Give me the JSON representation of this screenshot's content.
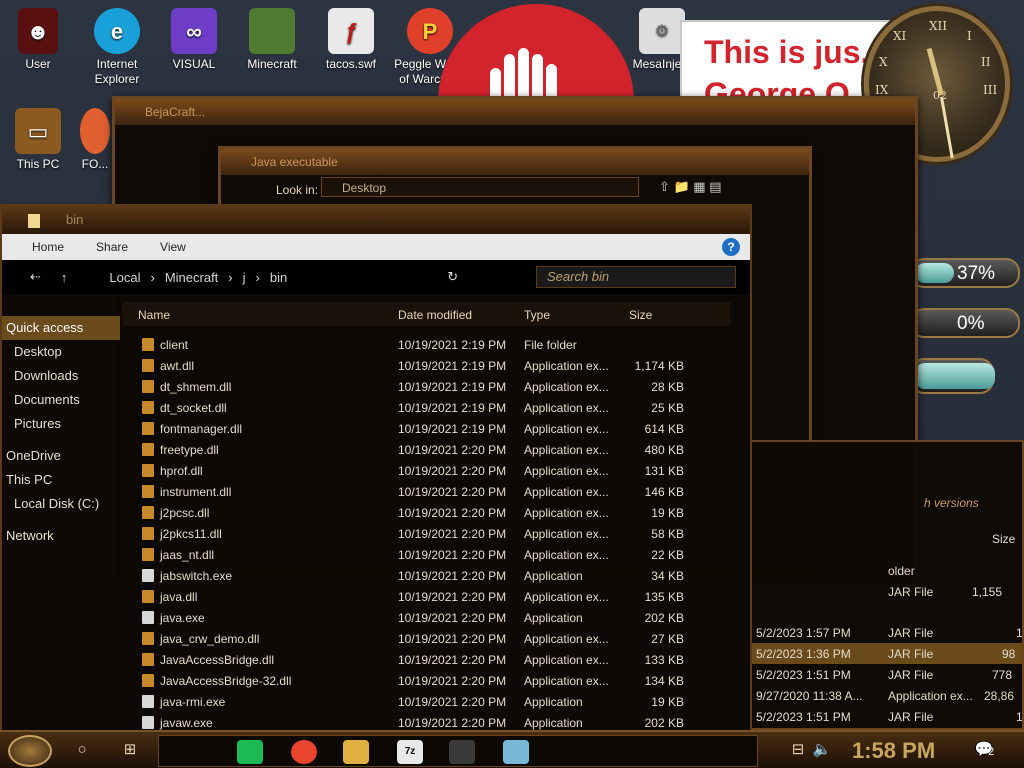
{
  "desktop_icons": [
    {
      "label": "User",
      "icon": "user-icon",
      "color": "#6a1010"
    },
    {
      "label": "Internet Explorer",
      "icon": "ie-icon",
      "color": "#1aa0d8"
    },
    {
      "label": "VISUAL",
      "icon": "visual-studio-icon",
      "color": "#6e3ec8"
    },
    {
      "label": "Minecraft",
      "icon": "minecraft-icon",
      "color": "#4f7a30"
    },
    {
      "label": "tacos.swf",
      "icon": "flash-file-icon",
      "color": "#e9e9e9"
    },
    {
      "label": "Peggle World of Warcra...",
      "icon": "peggle-icon",
      "color": "#e0402a"
    },
    {
      "label": "MesaInje...",
      "icon": "mesa-icon",
      "color": "#dddddd"
    },
    {
      "label": "This PC",
      "icon": "this-pc-icon",
      "color": "#8a5a20"
    },
    {
      "label": "FO...",
      "icon": "fo-icon",
      "color": "#e06030"
    }
  ],
  "banner": {
    "line1": "This is jus...",
    "line2": "George O..."
  },
  "clock": {
    "numerals": [
      "XII",
      "I",
      "II",
      "III",
      "IX",
      "X",
      "XI"
    ],
    "sub": "02"
  },
  "gauges": [
    {
      "label": "37%",
      "value": 0.37
    },
    {
      "label": "0%",
      "value": 0.0
    }
  ],
  "back_window1": {
    "title": "BejaCraft..."
  },
  "dialog": {
    "title": "Java executable",
    "look_in_label": "Look in:",
    "look_in_value": "Desktop"
  },
  "explorer": {
    "title": "bin",
    "ribbon_tabs": [
      "Home",
      "Share",
      "View"
    ],
    "breadcrumb": [
      "Local",
      "Minecraft",
      "j",
      "bin"
    ],
    "search_placeholder": "Search bin",
    "columns": {
      "name": "Name",
      "date": "Date modified",
      "type": "Type",
      "size": "Size"
    },
    "nav": {
      "quick_access": "Quick access",
      "desktop": "Desktop",
      "downloads": "Downloads",
      "documents": "Documents",
      "pictures": "Pictures",
      "onedrive": "OneDrive",
      "this_pc": "This PC",
      "local_disk": "Local Disk (C:)",
      "network": "Network"
    },
    "files": [
      {
        "name": "client",
        "date": "10/19/2021 2:19 PM",
        "type": "File folder",
        "size": ""
      },
      {
        "name": "awt.dll",
        "date": "10/19/2021 2:19 PM",
        "type": "Application ex...",
        "size": "1,174 KB"
      },
      {
        "name": "dt_shmem.dll",
        "date": "10/19/2021 2:19 PM",
        "type": "Application ex...",
        "size": "28 KB"
      },
      {
        "name": "dt_socket.dll",
        "date": "10/19/2021 2:19 PM",
        "type": "Application ex...",
        "size": "25 KB"
      },
      {
        "name": "fontmanager.dll",
        "date": "10/19/2021 2:19 PM",
        "type": "Application ex...",
        "size": "614 KB"
      },
      {
        "name": "freetype.dll",
        "date": "10/19/2021 2:20 PM",
        "type": "Application ex...",
        "size": "480 KB"
      },
      {
        "name": "hprof.dll",
        "date": "10/19/2021 2:20 PM",
        "type": "Application ex...",
        "size": "131 KB"
      },
      {
        "name": "instrument.dll",
        "date": "10/19/2021 2:20 PM",
        "type": "Application ex...",
        "size": "146 KB"
      },
      {
        "name": "j2pcsc.dll",
        "date": "10/19/2021 2:20 PM",
        "type": "Application ex...",
        "size": "19 KB"
      },
      {
        "name": "j2pkcs11.dll",
        "date": "10/19/2021 2:20 PM",
        "type": "Application ex...",
        "size": "58 KB"
      },
      {
        "name": "jaas_nt.dll",
        "date": "10/19/2021 2:20 PM",
        "type": "Application ex...",
        "size": "22 KB"
      },
      {
        "name": "jabswitch.exe",
        "date": "10/19/2021 2:20 PM",
        "type": "Application",
        "size": "34 KB"
      },
      {
        "name": "java.dll",
        "date": "10/19/2021 2:20 PM",
        "type": "Application ex...",
        "size": "135 KB"
      },
      {
        "name": "java.exe",
        "date": "10/19/2021 2:20 PM",
        "type": "Application",
        "size": "202 KB"
      },
      {
        "name": "java_crw_demo.dll",
        "date": "10/19/2021 2:20 PM",
        "type": "Application ex...",
        "size": "27 KB"
      },
      {
        "name": "JavaAccessBridge.dll",
        "date": "10/19/2021 2:20 PM",
        "type": "Application ex...",
        "size": "133 KB"
      },
      {
        "name": "JavaAccessBridge-32.dll",
        "date": "10/19/2021 2:20 PM",
        "type": "Application ex...",
        "size": "134 KB"
      },
      {
        "name": "java-rmi.exe",
        "date": "10/19/2021 2:20 PM",
        "type": "Application",
        "size": "19 KB"
      },
      {
        "name": "javaw.exe",
        "date": "10/19/2021 2:20 PM",
        "type": "Application",
        "size": "202 KB"
      }
    ]
  },
  "right_list": {
    "header_label": "h versions",
    "size_label": "Size",
    "rows": [
      {
        "date": "",
        "type": "older",
        "size": ""
      },
      {
        "date": "",
        "type": "JAR File",
        "size": "1,155"
      },
      {
        "date": "5/2/2023 1:57 PM",
        "type": "JAR File",
        "size": "1"
      },
      {
        "date": "5/2/2023 1:36 PM",
        "type": "JAR File",
        "size": "98"
      },
      {
        "date": "5/2/2023 1:51 PM",
        "type": "JAR File",
        "size": "778"
      },
      {
        "date": "9/27/2020 11:38 A...",
        "type": "Application ex...",
        "size": "28,86"
      },
      {
        "date": "5/2/2023 1:51 PM",
        "type": "JAR File",
        "size": "1"
      }
    ]
  },
  "taskbar": {
    "time": "1:58 PM",
    "notification_count": "2",
    "apps": [
      {
        "name": "spotify-icon",
        "color": "#1db954",
        "label": ""
      },
      {
        "name": "chrome-icon",
        "color": "#e8452c",
        "label": ""
      },
      {
        "name": "file-explorer-icon",
        "color": "#e0b040",
        "label": ""
      },
      {
        "name": "7zip-icon",
        "color": "#e9e9e9",
        "label": "7z"
      },
      {
        "name": "minecraft-taskbar-icon",
        "color": "#3a3a3a",
        "label": ""
      },
      {
        "name": "notes-icon",
        "color": "#7ab8d8",
        "label": ""
      }
    ]
  }
}
